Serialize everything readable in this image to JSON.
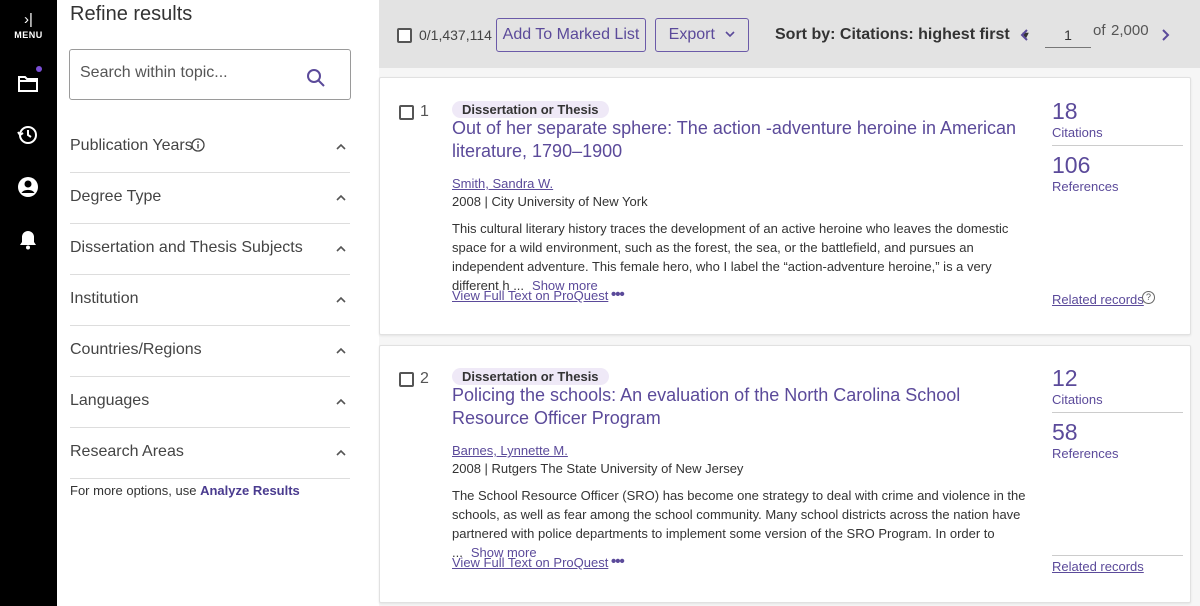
{
  "rail": {
    "menu_label": "MENU",
    "icons": [
      "expand-icon",
      "folder-icon",
      "history-icon",
      "user-icon",
      "bell-icon"
    ]
  },
  "refine": {
    "title": "Refine results",
    "search_placeholder": "Search within topic...",
    "facets": [
      {
        "label": "Publication Years",
        "has_info": true
      },
      {
        "label": "Degree Type"
      },
      {
        "label": "Dissertation and Thesis Subjects"
      },
      {
        "label": "Institution"
      },
      {
        "label": "Countries/Regions"
      },
      {
        "label": "Languages"
      },
      {
        "label": "Research Areas"
      }
    ],
    "more_options_text": "For more options, use",
    "analyze_link": "Analyze Results"
  },
  "toolbar": {
    "selected_count": "0/1,437,114",
    "add_marked": "Add To Marked List",
    "export": "Export",
    "sort_label": "Sort by:",
    "sort_value": "Citations: highest first",
    "page_current": "1",
    "page_of": "of",
    "page_total": "2,000"
  },
  "results": [
    {
      "index": "1",
      "type": "Dissertation or Thesis",
      "title": "Out of her separate sphere: The action -adventure heroine in American literature, 1790–1900",
      "author": "Smith, Sandra W.",
      "meta": "2008 | City University of New York",
      "abstract": "This cultural literary history traces the development of an active heroine who leaves the domestic space for a wild environment, such as the forest, the sea, or the battlefield, and pursues an independent adventure. This female hero, who I label the “action-adventure heroine,” is a very different h ...",
      "show_more": "Show more",
      "full_text": "View Full Text on ProQuest",
      "citations": "18",
      "citations_label": "Citations",
      "references": "106",
      "references_label": "References",
      "related": "Related records",
      "related_help": "?"
    },
    {
      "index": "2",
      "type": "Dissertation or Thesis",
      "title": "Policing the schools: An evaluation of the North Carolina School Resource Officer Program",
      "author": "Barnes, Lynnette M.",
      "meta": "2008 | Rutgers The State University of New Jersey",
      "abstract": "The School Resource Officer (SRO) has become one strategy to deal with crime and violence in the schools, as well as fear among the school community. Many school districts across the nation have partnered with police departments to implement some version of the SRO Program. In order to ...",
      "show_more": "Show more",
      "full_text": "View Full Text on ProQuest",
      "citations": "12",
      "citations_label": "Citations",
      "references": "58",
      "references_label": "References",
      "related": "Related records"
    }
  ],
  "colors": {
    "accent": "#5b4a9a",
    "rail": "#000000",
    "badge_bg": "#efe9f7",
    "toolbar_bg": "#e3e3e3"
  }
}
